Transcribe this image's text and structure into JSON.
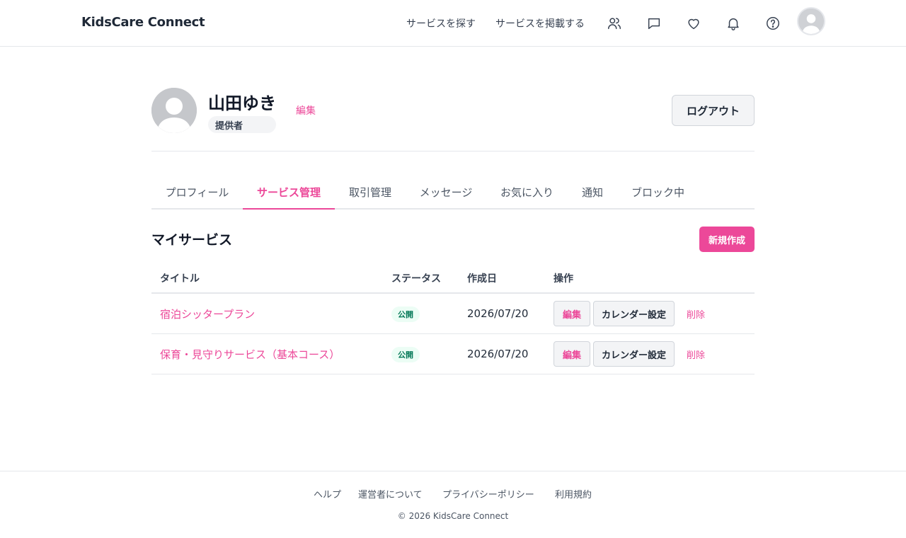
{
  "header": {
    "brand": "KidsCare Connect",
    "nav": {
      "find": "サービスを探す",
      "post": "サービスを掲載する"
    },
    "icons": [
      "users-icon",
      "message-icon",
      "heart-icon",
      "bell-icon",
      "help-icon",
      "avatar"
    ]
  },
  "profile": {
    "name": "山田ゆき",
    "role": "提供者",
    "edit_label": "編集",
    "logout_label": "ログアウト"
  },
  "tabs": [
    {
      "label": "プロフィール",
      "active": false
    },
    {
      "label": "サービス管理",
      "active": true
    },
    {
      "label": "取引管理",
      "active": false
    },
    {
      "label": "メッセージ",
      "active": false
    },
    {
      "label": "お気に入り",
      "active": false
    },
    {
      "label": "通知",
      "active": false
    },
    {
      "label": "ブロック中",
      "active": false
    }
  ],
  "services": {
    "title": "マイサービス",
    "new_label": "新規作成",
    "columns": [
      "タイトル",
      "ステータス",
      "作成日",
      "操作"
    ],
    "rows": [
      {
        "title": "宿泊シッタープラン",
        "status": "公開",
        "date": "2026/07/20",
        "edit": "編集",
        "calendar": "カレンダー設定",
        "delete": "削除"
      },
      {
        "title": "保育・見守りサービス（基本コース）",
        "status": "公開",
        "date": "2026/07/20",
        "edit": "編集",
        "calendar": "カレンダー設定",
        "delete": "削除"
      }
    ]
  },
  "footer": {
    "links": [
      "ヘルプ",
      "運営者について",
      "プライバシーポリシー",
      "利用規約"
    ],
    "copyright": "© 2026 KidsCare Connect"
  },
  "colors": {
    "accent": "#ec4899",
    "status_bg": "#ecfdf5",
    "status_text": "#047857"
  }
}
